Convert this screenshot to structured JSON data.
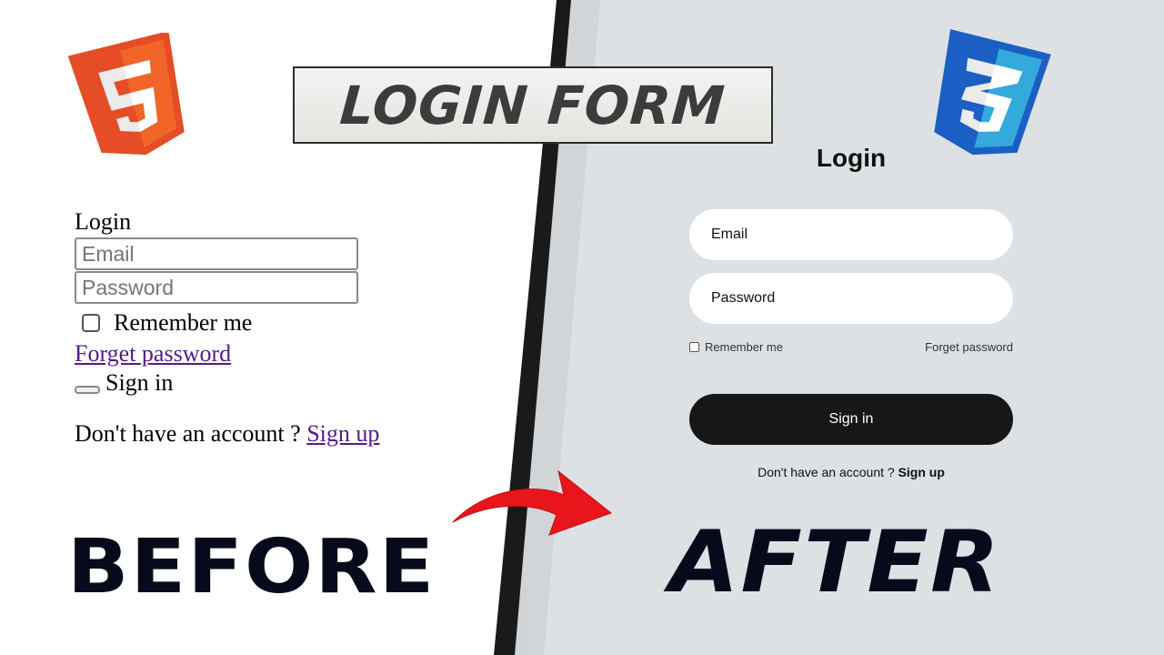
{
  "banner": {
    "title": "LOGIN FORM"
  },
  "logos": {
    "left": "html5-icon",
    "right": "css3-icon"
  },
  "before": {
    "heading": "Login",
    "email_placeholder": "Email",
    "password_placeholder": "Password",
    "remember_label": "Remember me",
    "forget_link": "Forget password",
    "signin_label": "Sign in",
    "signup_prompt": "Don't have an account ?",
    "signup_link": "Sign up",
    "label": "BEFORE"
  },
  "after": {
    "heading": "Login",
    "email_placeholder": "Email",
    "password_placeholder": "Password",
    "remember_label": "Remember me",
    "forget_link": "Forget password",
    "signin_label": "Sign in",
    "signup_prompt": "Don't have an account ?",
    "signup_link": "Sign up",
    "label": "AFTER"
  },
  "colors": {
    "left_bg": "#ffffff",
    "right_bg": "#dde1e4",
    "button_dark": "#171717",
    "arrow": "#e8161b",
    "html5": "#e44d26",
    "css3": "#1b5fc4"
  }
}
